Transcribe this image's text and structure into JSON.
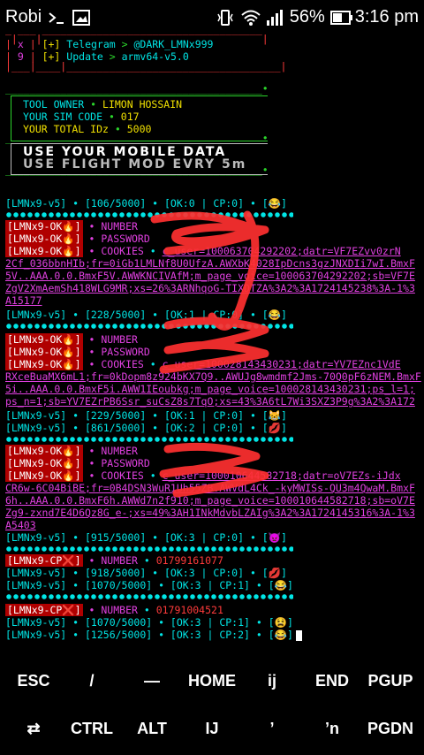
{
  "status": {
    "carrier": "Robi",
    "battery_percent": "56%",
    "time": "3:16 pm"
  },
  "header_table": {
    "rows": [
      {
        "num": "x",
        "tag": "[+]",
        "name": "Telegram",
        "value": "@DARK_LMNx999"
      },
      {
        "num": "9",
        "tag": "[+]",
        "name": "Update",
        "value": "armv64-v5.0"
      }
    ]
  },
  "info_box": {
    "owner_label": "TOOL OWNER",
    "owner_value": "LIMON HOSSAIN",
    "sim_label": "YOUR SIM CODE",
    "sim_value": "017",
    "ids_label": "YOUR TOTAL IDz",
    "ids_value": "5000"
  },
  "banner": {
    "line1": "USE YOUR MOBILE DATA",
    "line2": "USE FLIGHT MOD EVRY 5m"
  },
  "progress_lines": {
    "p1": "[LMNx9-v5] • [106/5000] • [OK:0 | CP:0] • [😂]",
    "p2": "[LMNx9-v5] • [228/5000] • [OK:1 | CP:0] • [😂]",
    "p3": "[LMNx9-v5] • [229/5000] • [OK:1 | CP:0] • [😹]",
    "p4": "[LMNx9-v5] • [861/5000] • [OK:2 | CP:0] • [💋]",
    "p5": "[LMNx9-v5] • [915/5000] • [OK:3 | CP:0] • [👿]",
    "p6": "[LMNx9-v5] • [918/5000] • [OK:3 | CP:0] • [💋]",
    "p7": "[LMNx9-v5] • [1070/5000] • [OK:3 | CP:1] • [😂]",
    "p8": "[LMNx9-v5] • [1070/5000] • [OK:3 | CP:1] • [😫]",
    "p9": "[LMNx9-v5] • [1256/5000] • [OK:3 | CP:2] • [😂]"
  },
  "ok_blocks": [
    {
      "tag": "[LMNx9-OK🔥]",
      "number_label": "NUMBER",
      "password_label": "PASSWORD",
      "cookies_label": "COOKIES",
      "cookie_lines": [
        "c_user=100063704292202;datr=VF7EZvv0zrN",
        "2Cf_036bbnHIb;fr=0iGb1LMLNf8U0UfzA.AWXbK4028IpDcns3gzJNXDIi7wI.BmxF",
        "5V..AAA.0.0.BmxF5V.AWWKNCIVAfM;m_page_voice=100063704292202;sb=VF7E",
        "ZgV2XmAemSh418WLG9MR;xs=26%3ARNhqoG-TIXDTZA%3A2%3A1724145238%3A-1%3",
        "A15177"
      ]
    },
    {
      "tag": "[LMNx9-OK🔥]",
      "number_label": "NUMBER",
      "password_label": "PASSWORD",
      "cookies_label": "COOKIES",
      "cookie_lines": [
        "c_user=100028143430231;datr=YV7EZnc1VdE",
        "RXceBuaMX6mL1;fr=0kDopm8z924bKX7Q9..AWUJg8wmdmf2Jms-70Q0pF6zNEM.BmxF",
        "5i..AAA.0.0.BmxF5i.AWW1IEoubkg;m_page_voice=100028143430231;ps_l=1;",
        "ps_n=1;sb=YV7EZrPB6Ssr_suCsZ8s7TqO;xs=43%3A6tL7Wi3SXZ3P9g%3A2%3A172"
      ]
    },
    {
      "tag": "[LMNx9-OK🔥]",
      "number_label": "NUMBER",
      "password_label": "PASSWORD",
      "cookies_label": "COOKIES",
      "cookie_lines": [
        "c_user=100010644582718;datr=oV7EZs-iJdx",
        "CR6w-6C04BiBE;fr=0B4DSN3WuR1Uh55ZB.AWVdL4Ck_-kyMWISs-QU3m4QwaM.BmxF",
        "6h..AAA.0.0.BmxF6h.AWWd7n2f910;m_page_voice=100010644582718;sb=oV7E",
        "Zg9-zxnd7E4D6Qz8G_e-;xs=49%3AH1INkMdvbLZAIg%3A2%3A1724145316%3A-1%3",
        "A5403"
      ]
    }
  ],
  "cp_blocks": [
    {
      "tag": "[LMNx9-CP❌]",
      "number_label": "NUMBER",
      "number_value": "01799161077"
    },
    {
      "tag": "[LMNx9-CP❌]",
      "number_label": "NUMBER",
      "number_value": "01791004521"
    }
  ],
  "keys": {
    "row1": [
      "ESC",
      "/",
      "—",
      "HOME",
      "ij",
      "END",
      "PGUP"
    ],
    "row2": [
      "⇄",
      "CTRL",
      "ALT",
      "IJ",
      "’",
      "’n",
      "PGDN"
    ]
  },
  "colors": {
    "cyan": "#00e5e5",
    "green": "#2bd42b",
    "yellow": "#f0e000",
    "red": "#ff3b3b",
    "magenta": "#e040e0",
    "ok_tag_bg": "#b00000",
    "scribble": "#ff3030"
  },
  "icons": [
    "terminal-prompt-icon",
    "gallery-icon",
    "vibrate-icon",
    "wifi-icon",
    "signal-icon",
    "battery-icon"
  ]
}
